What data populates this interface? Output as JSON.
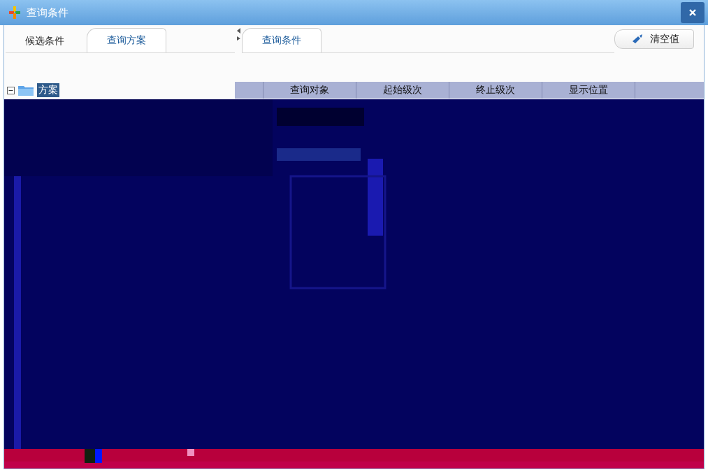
{
  "window": {
    "title": "查询条件"
  },
  "left_panel": {
    "tabs": [
      {
        "label": "候选条件",
        "selected": false
      },
      {
        "label": "查询方案",
        "selected": true
      }
    ],
    "tree": [
      {
        "label": "方案",
        "selected": true,
        "expanded": true
      }
    ]
  },
  "right_panel": {
    "tabs": [
      {
        "label": "查询条件",
        "selected": true
      }
    ],
    "clear_button": "清空值",
    "table": {
      "columns": [
        "查询对象",
        "起始级次",
        "终止级次",
        "显示位置"
      ]
    }
  }
}
